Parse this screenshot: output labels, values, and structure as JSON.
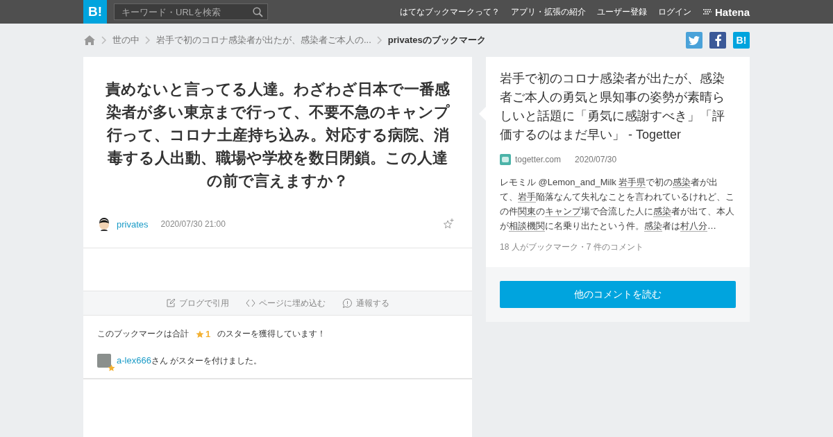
{
  "header": {
    "logo": "B!",
    "search": {
      "placeholder": "キーワード・URLを検索"
    },
    "nav": [
      "はてなブックマークって？",
      "アプリ・拡張の紹介",
      "ユーザー登録",
      "ログイン"
    ],
    "brand": "Hatena"
  },
  "breadcrumb": [
    {
      "label": "世の中",
      "current": false
    },
    {
      "label": "岩手で初のコロナ感染者が出たが、感染者ご本人の...",
      "current": false
    },
    {
      "label": "privatesのブックマーク",
      "current": true
    }
  ],
  "share_buttons": [
    {
      "kind": "twitter"
    },
    {
      "kind": "facebook"
    },
    {
      "kind": "hatena",
      "label": "B!"
    }
  ],
  "bookmark": {
    "comment": "責めないと言ってる人達。わざわざ日本で一番感染者が多い東京まで行って、不要不急のキャンプ行って、コロナ土産持ち込み。対応する病院、消毒する人出動、職場や学校を数日閉鎖。この人達の前で言えますか？",
    "user": "privates",
    "date": "2020/07/30 21:00"
  },
  "actions": [
    {
      "kind": "quote",
      "label": "ブログで引用"
    },
    {
      "kind": "embed",
      "label": "ページに埋め込む"
    },
    {
      "kind": "report",
      "label": "通報する"
    }
  ],
  "stars": {
    "prefix": "このブックマークは合計",
    "count": "1",
    "suffix": "のスターを獲得しています！"
  },
  "star_givers": [
    {
      "user": "a-lex666",
      "text": "さん がスターを付けました。"
    }
  ],
  "entry": {
    "title": "岩手で初のコロナ感染者が出たが、感染者ご本人の勇気と県知事の姿勢が素晴らしいと話題に「勇気に感謝すべき」「評価するのはまだ早い」 - Togetter",
    "domain": "togetter.com",
    "date": "2020/07/30",
    "summary": [
      {
        "kind": "text",
        "text": "レモミル @Lemon_and_Milk "
      },
      {
        "kind": "keyword",
        "text": "岩手県"
      },
      {
        "kind": "text",
        "text": "で初の"
      },
      {
        "kind": "keyword",
        "text": "感染"
      },
      {
        "kind": "text",
        "text": "者が出て、"
      },
      {
        "kind": "keyword",
        "text": "岩手"
      },
      {
        "kind": "text",
        "text": "陥落なんて失礼なことを言われているけれど、この件"
      },
      {
        "kind": "keyword",
        "text": "関東"
      },
      {
        "kind": "text",
        "text": "の"
      },
      {
        "kind": "keyword",
        "text": "キャンプ"
      },
      {
        "kind": "text",
        "text": "場で合流した人に"
      },
      {
        "kind": "keyword",
        "text": "感染"
      },
      {
        "kind": "text",
        "text": "者が出て、本人が"
      },
      {
        "kind": "keyword",
        "text": "相談機関"
      },
      {
        "kind": "text",
        "text": "に名乗り出たという件。"
      },
      {
        "kind": "keyword",
        "text": "感染"
      },
      {
        "kind": "text",
        "text": "者は"
      },
      {
        "kind": "keyword",
        "text": "村八分"
      },
      {
        "kind": "text",
        "text": "…"
      }
    ],
    "count": "18 人がブックマーク・7 件のコメント",
    "button": "他のコメントを読む"
  }
}
